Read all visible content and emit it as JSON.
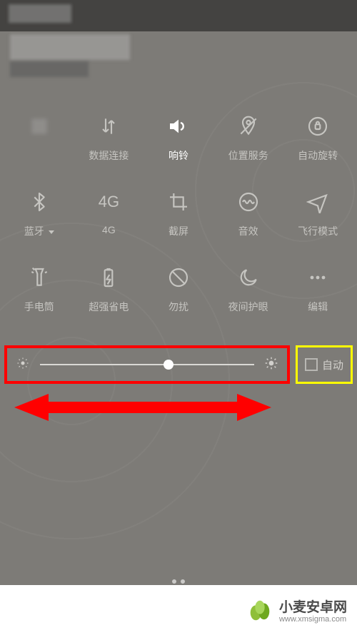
{
  "tiles": {
    "row1": [
      {
        "label": "",
        "name": "tile-unknown-1"
      },
      {
        "label": "数据连接",
        "name": "tile-data-connection"
      },
      {
        "label": "响铃",
        "name": "tile-sound-ring",
        "active": true
      },
      {
        "label": "位置服务",
        "name": "tile-location"
      },
      {
        "label": "自动旋转",
        "name": "tile-auto-rotate"
      }
    ],
    "row2": [
      {
        "label": "蓝牙",
        "name": "tile-bluetooth",
        "caret": true
      },
      {
        "label": "4G",
        "name": "tile-4g"
      },
      {
        "label": "截屏",
        "name": "tile-screenshot"
      },
      {
        "label": "音效",
        "name": "tile-sound-effect"
      },
      {
        "label": "飞行模式",
        "name": "tile-airplane"
      }
    ],
    "row3": [
      {
        "label": "手电筒",
        "name": "tile-flashlight"
      },
      {
        "label": "超强省电",
        "name": "tile-power-save"
      },
      {
        "label": "勿扰",
        "name": "tile-dnd"
      },
      {
        "label": "夜间护眼",
        "name": "tile-night"
      },
      {
        "label": "编辑",
        "name": "tile-edit"
      }
    ]
  },
  "brightness": {
    "percent": 60,
    "auto_label": "自动",
    "auto_checked": false
  },
  "watermark": {
    "name": "小麦安卓网",
    "url": "www.xmsigma.com"
  },
  "colors": {
    "bg": "#7d7b77",
    "inactive": "#c6c5c1",
    "active": "#ffffff",
    "highlight_red": "#ff0000",
    "highlight_yellow": "#ffff00"
  }
}
